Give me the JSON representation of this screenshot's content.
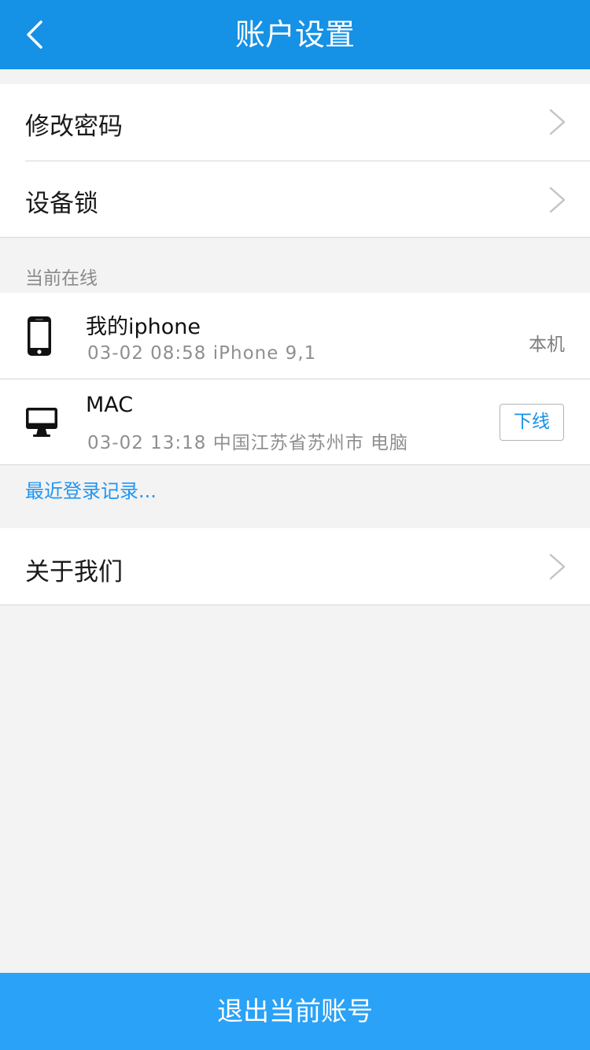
{
  "header": {
    "title": "账户设置",
    "back_icon": "chevron-left-icon",
    "color": "#1591e6"
  },
  "settings": {
    "items": [
      {
        "label": "修改密码",
        "icon": "chevron-right-icon"
      },
      {
        "label": "设备锁",
        "icon": "chevron-right-icon"
      }
    ]
  },
  "online": {
    "section_title": "当前在线",
    "devices": [
      {
        "name": "我的iphone",
        "detail": "03-02 08:58 iPhone 9,1",
        "tag": "本机",
        "icon": "phone-icon"
      },
      {
        "name": "MAC",
        "detail": "03-02 13:18 中国江苏省苏州市 电脑",
        "action": "下线",
        "icon": "desktop-icon"
      }
    ],
    "recent_link": "最近登录记录..."
  },
  "about": {
    "label": "关于我们",
    "icon": "chevron-right-icon"
  },
  "footer": {
    "logout_label": "退出当前账号",
    "color": "#2aa2f7"
  }
}
